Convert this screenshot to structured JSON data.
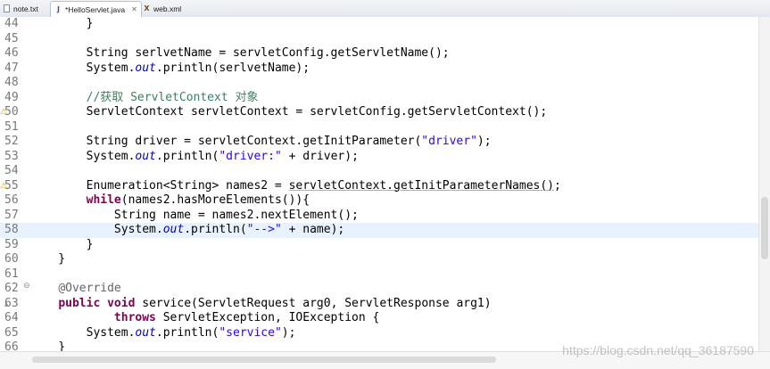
{
  "tabs": [
    {
      "label": "note.txt",
      "icon": "text-file-icon"
    },
    {
      "label": "*HelloServlet.java",
      "icon": "java-file-icon",
      "active": true
    },
    {
      "label": "web.xml",
      "icon": "xml-file-icon"
    }
  ],
  "editor": {
    "lines": [
      {
        "n": "44",
        "code": "        }"
      },
      {
        "n": "45",
        "code": ""
      },
      {
        "n": "46",
        "code": "        String serlvetName = servletConfig.getServletName();"
      },
      {
        "n": "47",
        "code": "        System.out.println(serlvetName);"
      },
      {
        "n": "48",
        "code": ""
      },
      {
        "n": "49",
        "code": "        //获取 ServletContext 对象"
      },
      {
        "n": "50",
        "code": "        ServletContext servletContext = servletConfig.getServletContext();"
      },
      {
        "n": "51",
        "code": ""
      },
      {
        "n": "52",
        "code": "        String driver = servletContext.getInitParameter(\"driver\");"
      },
      {
        "n": "53",
        "code": "        System.out.println(\"driver:\" + driver);"
      },
      {
        "n": "54",
        "code": ""
      },
      {
        "n": "55",
        "code": "        Enumeration<String> names2 = servletContext.getInitParameterNames();"
      },
      {
        "n": "56",
        "code": "        while(names2.hasMoreElements()){"
      },
      {
        "n": "57",
        "code": "            String name = names2.nextElement();"
      },
      {
        "n": "58",
        "code": "            System.out.println(\"-->\" + name);"
      },
      {
        "n": "59",
        "code": "        }"
      },
      {
        "n": "60",
        "code": "    }"
      },
      {
        "n": "61",
        "code": ""
      },
      {
        "n": "62",
        "code": "    @Override"
      },
      {
        "n": "63",
        "code": "    public void service(ServletRequest arg0, ServletResponse arg1)"
      },
      {
        "n": "64",
        "code": "            throws ServletException, IOException {"
      },
      {
        "n": "65",
        "code": "        System.out.println(\"service\");"
      },
      {
        "n": "66",
        "code": "    }"
      }
    ],
    "current_line": "58"
  },
  "watermark": "https://blog.csdn.net/qq_36187590",
  "colors": {
    "keyword": "#7f0055",
    "string": "#2a00ff",
    "static_field": "#0000c0",
    "comment": "#3f7f5f",
    "current_line": "#e8f2fe",
    "line_number": "#787878"
  }
}
